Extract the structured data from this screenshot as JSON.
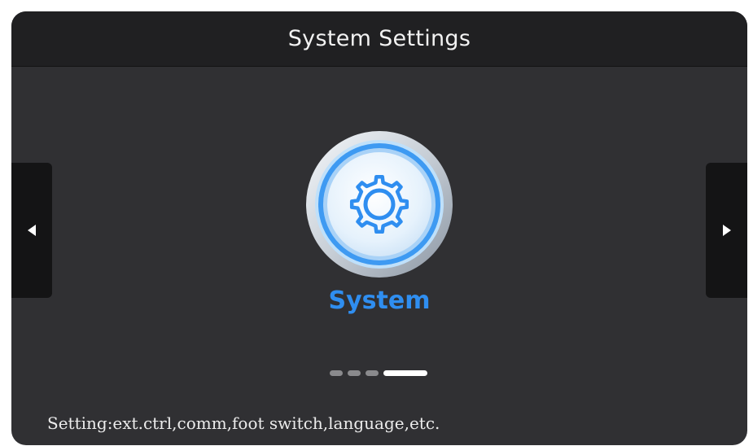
{
  "header": {
    "title": "System Settings"
  },
  "navigation": {
    "prev_icon": "triangle-left-icon",
    "next_icon": "triangle-right-icon"
  },
  "current_item": {
    "label": "System",
    "icon": "gear-icon",
    "accent_color": "#2f8ef0"
  },
  "pager": {
    "total_pages": 4,
    "active_page": 4
  },
  "footer": {
    "description": "Setting:ext.ctrl,comm,foot switch,language,etc."
  },
  "colors": {
    "background": "#303033",
    "title_bar": "#202022",
    "nav_button": "#141415",
    "accent": "#2f8ef0"
  }
}
